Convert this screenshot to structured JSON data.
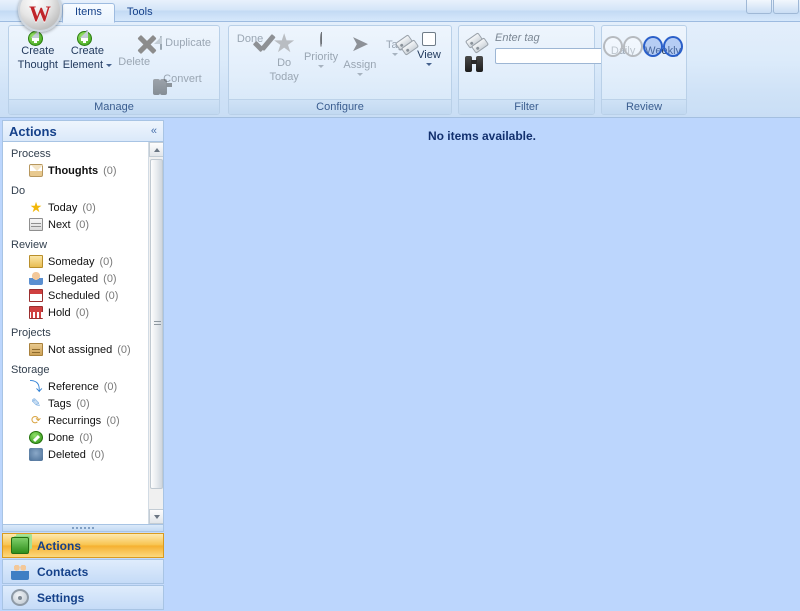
{
  "app": {
    "logo_letter": "W",
    "logo_icon": "app-menu-orb"
  },
  "window_controls": [
    {
      "name": "minimize-button",
      "label": ""
    },
    {
      "name": "maximize-button",
      "label": ""
    }
  ],
  "tabs": [
    {
      "label": "Items",
      "active": true
    },
    {
      "label": "Tools",
      "active": false
    }
  ],
  "ribbon": {
    "groups": {
      "manage": {
        "label": "Manage",
        "create_thought": {
          "label_line1": "Create",
          "label_line2": "Thought",
          "icon": "new-document-icon",
          "enabled": true
        },
        "create_element": {
          "label_line1": "Create",
          "label_line2": "Element",
          "icon": "new-element-icon",
          "enabled": true,
          "has_dropdown": true
        },
        "delete": {
          "label": "Delete",
          "icon": "delete-x-icon",
          "enabled": false
        },
        "duplicate": {
          "label": "Duplicate",
          "icon": "duplicate-icon",
          "enabled": false
        },
        "convert": {
          "label": "Convert",
          "icon": "convert-icon",
          "enabled": false
        }
      },
      "configure": {
        "label": "Configure",
        "buttons": [
          {
            "label_line1": "Done",
            "label_line2": "",
            "icon": "checkmark-icon",
            "enabled": false,
            "has_dropdown": false
          },
          {
            "label_line1": "Do",
            "label_line2": "Today",
            "icon": "star-icon",
            "enabled": false,
            "has_dropdown": false
          },
          {
            "label_line1": "Priority",
            "label_line2": "",
            "icon": "pie-chart-icon",
            "enabled": false,
            "has_dropdown": true
          },
          {
            "label_line1": "Assign",
            "label_line2": "",
            "icon": "assign-arrow-icon",
            "enabled": false,
            "has_dropdown": true
          },
          {
            "label_line1": "Tag",
            "label_line2": "",
            "icon": "tag-icon",
            "enabled": false,
            "has_dropdown": true
          },
          {
            "label_line1": "View",
            "label_line2": "",
            "icon": "view-window-icon",
            "enabled": true,
            "has_dropdown": true
          }
        ]
      },
      "filter": {
        "label": "Filter",
        "tag_icon": "tag-filter-icon",
        "search_icon": "binoculars-icon",
        "tag_placeholder": "Enter tag",
        "tag_value": "",
        "search_value": ""
      },
      "review": {
        "label": "Review",
        "daily": {
          "label": "Daily",
          "icon": "daily-rings-icon",
          "active": false
        },
        "weekly": {
          "label": "Weekly",
          "icon": "weekly-rings-icon",
          "active": true
        }
      }
    }
  },
  "sidebar": {
    "title": "Actions",
    "collapse_icon": "chevron-double-left-icon",
    "groups": [
      {
        "name": "Process",
        "items": [
          {
            "label": "Thoughts",
            "count": "(0)",
            "icon": "thoughts-envelope-icon",
            "bold": true
          }
        ]
      },
      {
        "name": "Do",
        "items": [
          {
            "label": "Today",
            "count": "(0)",
            "icon": "today-star-icon",
            "bold": false
          },
          {
            "label": "Next",
            "count": "(0)",
            "icon": "next-list-icon",
            "bold": false
          }
        ]
      },
      {
        "name": "Review",
        "items": [
          {
            "label": "Someday",
            "count": "(0)",
            "icon": "someday-folder-icon",
            "bold": false
          },
          {
            "label": "Delegated",
            "count": "(0)",
            "icon": "delegated-person-icon",
            "bold": false
          },
          {
            "label": "Scheduled",
            "count": "(0)",
            "icon": "scheduled-calendar-icon",
            "bold": false
          },
          {
            "label": "Hold",
            "count": "(0)",
            "icon": "hold-calendar-icon",
            "bold": false
          }
        ]
      },
      {
        "name": "Projects",
        "items": [
          {
            "label": "Not assigned",
            "count": "(0)",
            "icon": "project-box-icon",
            "bold": false
          }
        ]
      },
      {
        "name": "Storage",
        "items": [
          {
            "label": "Reference",
            "count": "(0)",
            "icon": "reference-arrow-icon",
            "bold": false
          },
          {
            "label": "Tags",
            "count": "(0)",
            "icon": "tags-pencil-icon",
            "bold": false
          },
          {
            "label": "Recurrings",
            "count": "(0)",
            "icon": "recurring-icon",
            "bold": false
          },
          {
            "label": "Done",
            "count": "(0)",
            "icon": "done-check-icon",
            "bold": false
          },
          {
            "label": "Deleted",
            "count": "(0)",
            "icon": "deleted-icon",
            "bold": false
          }
        ]
      }
    ],
    "scrollbar": {
      "up_icon": "scroll-up-arrow-icon",
      "down_icon": "scroll-down-arrow-icon"
    },
    "nav": [
      {
        "label": "Actions",
        "icon": "actions-stack-icon",
        "selected": true
      },
      {
        "label": "Contacts",
        "icon": "contacts-people-icon",
        "selected": false
      },
      {
        "label": "Settings",
        "icon": "settings-gear-icon",
        "selected": false
      }
    ]
  },
  "main": {
    "empty_message": "No items available."
  },
  "colors": {
    "accent_blue": "#15418a",
    "content_bg": "#bcd6fd",
    "selected_nav": "#f5b02f",
    "logo_red": "#c0252a"
  }
}
